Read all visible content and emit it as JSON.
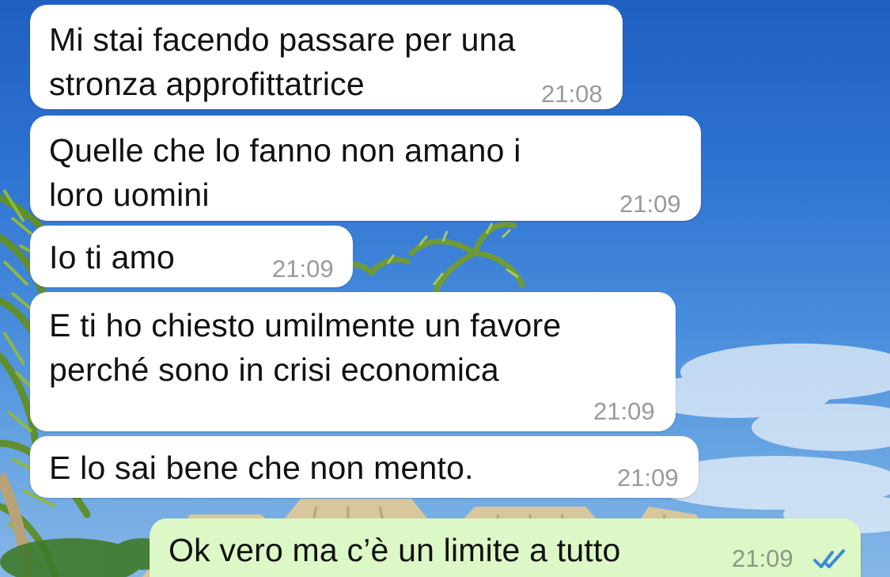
{
  "conversation": {
    "messages": [
      {
        "direction": "incoming",
        "text": "Mi stai facendo passare per una\nstronza approfittatrice",
        "time": "21:08"
      },
      {
        "direction": "incoming",
        "text": "Quelle che lo fanno non amano i\nloro uomini",
        "time": "21:09"
      },
      {
        "direction": "incoming",
        "text": "Io ti amo",
        "time": "21:09"
      },
      {
        "direction": "incoming",
        "text": "E ti ho chiesto umilmente un favore\nperché sono in crisi economica",
        "time": "21:09"
      },
      {
        "direction": "incoming",
        "text": "E lo sai bene che non mento.",
        "time": "21:09"
      },
      {
        "direction": "outgoing",
        "text": "Ok vero ma c’è un limite a tutto",
        "time": "21:09",
        "status_icon": "double-check-read-icon"
      }
    ]
  },
  "colors": {
    "incoming_bubble": "#ffffff",
    "outgoing_bubble": "#dcf8c6",
    "read_receipt": "#3d8bd8",
    "sky": "#2f74d2"
  }
}
